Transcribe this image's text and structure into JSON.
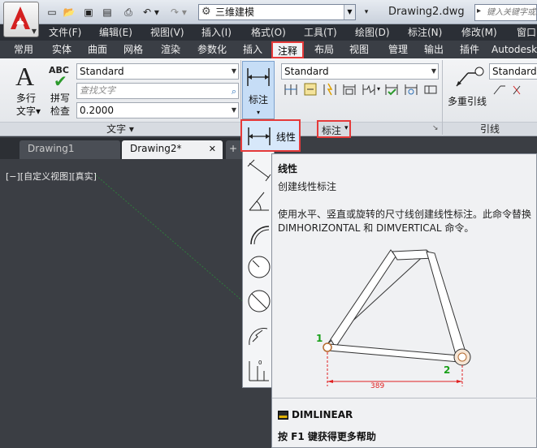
{
  "window": {
    "workspace": "三维建模",
    "document_title": "Drawing2.dwg",
    "search_placeholder": "键入关键字或短语"
  },
  "menubar": [
    "文件(F)",
    "编辑(E)",
    "视图(V)",
    "插入(I)",
    "格式(O)",
    "工具(T)",
    "绘图(D)",
    "标注(N)",
    "修改(M)",
    "窗口"
  ],
  "ribbon_tabs": [
    "常用",
    "实体",
    "曲面",
    "网格",
    "渲染",
    "参数化",
    "插入",
    "注释",
    "布局",
    "视图",
    "管理",
    "输出",
    "插件",
    "Autodesk"
  ],
  "active_tab": "注释",
  "text_panel": {
    "multiline_label_1": "多行",
    "multiline_label_2": "文字",
    "spell_abc": "ABC",
    "spell_label_1": "拼写",
    "spell_label_2": "检查",
    "style_value": "Standard",
    "find_placeholder": "查找文字",
    "height_value": "0.2000",
    "title": "文字"
  },
  "dim_panel": {
    "button_label": "标注",
    "style_value": "Standard",
    "title": "标注"
  },
  "leader_panel": {
    "multileader_label": "多重引线",
    "style_value": "Standard",
    "title": "引线"
  },
  "file_tabs": [
    {
      "name": "Drawing1",
      "active": false
    },
    {
      "name": "Drawing2*",
      "active": true
    }
  ],
  "viewport_label": "[−][自定义视图][真实]",
  "flyout": {
    "selected_label": "线性"
  },
  "tooltip": {
    "title": "线性",
    "subtitle": "创建线性标注",
    "description": "使用水平、竖直或旋转的尺寸线创建线性标注。此命令替换 DIMHORIZONTAL 和 DIMVERTICAL 命令。",
    "dim_value": "389",
    "point_1": "1",
    "point_2": "2",
    "command": "DIMLINEAR",
    "help": "按 F1 键获得更多帮助"
  },
  "colors": {
    "highlight_border": "#e53a3a",
    "canvas": "#3b3e44",
    "dim_red": "#e02020",
    "point_green": "#1aa01a"
  }
}
